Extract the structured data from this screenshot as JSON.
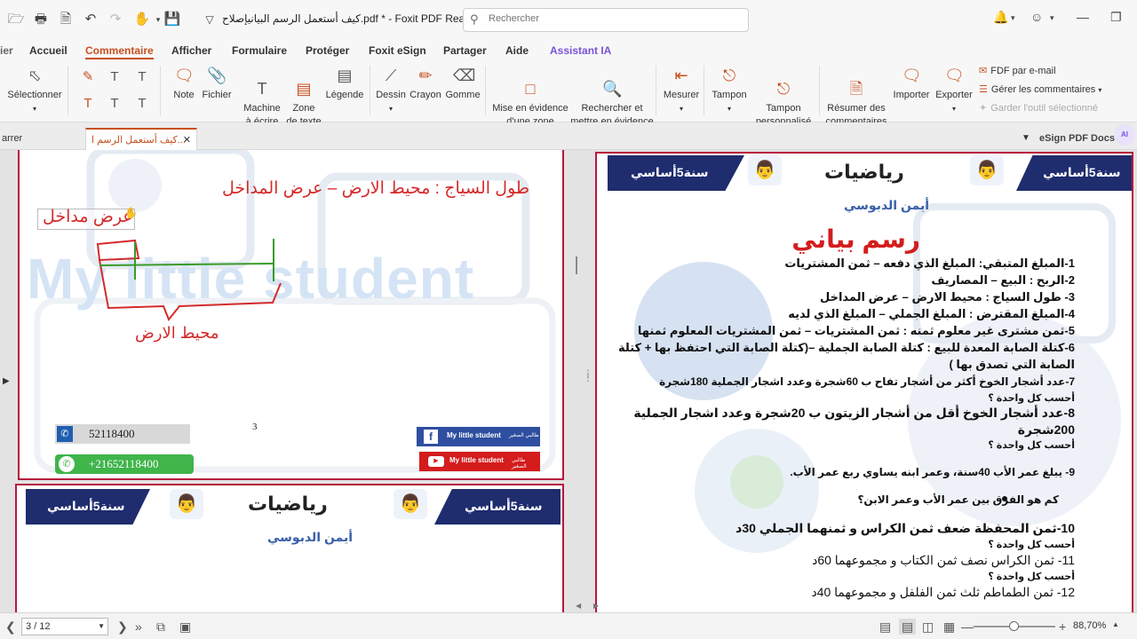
{
  "app": {
    "title": "كيف أستعمل الرسم البيانيإصلاح.pdf * - Foxit PDF Reader",
    "search_placeholder": "Rechercher"
  },
  "menu": {
    "items": [
      "Accueil",
      "Commentaire",
      "Afficher",
      "Formulaire",
      "Protéger",
      "Foxit eSign",
      "Partager",
      "Aide",
      "Assistant IA"
    ],
    "active": "Commentaire"
  },
  "ribbon": {
    "select": "Sélectionner",
    "note": "Note",
    "file": "Fichier",
    "typewriter": "Machine\nà écrire",
    "textbox": "Zone\nde texte",
    "legend": "Légende",
    "drawing": "Dessin",
    "pencil": "Crayon",
    "eraser": "Gomme",
    "area_highlight": "Mise en évidence\nd'une zone",
    "search_highlight": "Rechercher et\nmettre en évidence",
    "measure": "Mesurer",
    "stamp": "Tampon",
    "custom_stamp": "Tampon\npersonnalisé",
    "summarize": "Résumer des\ncommentaires",
    "import": "Importer",
    "export": "Exporter",
    "fdf_email": "FDF par e-mail",
    "manage_comments": "Gérer les commentaires",
    "keep_tool": "Garder l'outil sélectionné"
  },
  "tabs": {
    "left": "arrer",
    "active": "كيف أستعمل الرسم ا...",
    "esign": "eSign PDF Docs",
    "ai_badge": "AI"
  },
  "left_page": {
    "heading": "طول السياج : محيط الارض – عرض المداخل",
    "label_width": "عرض مداخل",
    "label_perimeter": "محيط الارض",
    "watermark": "My little student",
    "page_number": "3",
    "phone1": "52118400",
    "phone2": "+21652118400",
    "facebook": "My little student",
    "youtube": "My little student",
    "social_ar": "طالبي الصغير"
  },
  "left_page2": {
    "banner_left": "سنة5أساسي",
    "banner_right": "سنة5أساسي",
    "subject": "رياضيات",
    "author": "أيمن الدبوسي"
  },
  "right_page": {
    "banner_left": "سنة5أساسي",
    "banner_right": "سنة5أساسي",
    "subject": "رياضيات",
    "author": "أيمن الدبوسي",
    "title": "رسم بياني",
    "lines": [
      "1-المبلغ المتبقي:  المبلغ الذي دفعه – ثمن المشتريات",
      "2-الربح : البيع – المصاريف",
      "3- طول السياج : محيط الارض – عرض المداخل",
      "4-المبلغ المقترض : المبلغ الجملي – المبلغ الذي لديه",
      "5-ثمن مشترى غير معلوم ثمنه : ثمن المشتريات – ثمن المشتريات المعلوم ثمنها",
      "6-كتلة الصابة المعدة للبيع : كتلة الصابة الجملية –(كتلة الصابة التي احتفظ بها + كتلة",
      "الصابة التي تصدق بها )",
      "7-عدد أشجار الخوخ أكثر من أشجار تفاح ب 60شجرة وعدد اشجار الجملية 180شجرة",
      "أحسب كل واحدة ؟",
      "8-عدد أشجار الخوخ أقل من أشجار الزيتون ب 20شجرة  وعدد اشجار الجملية",
      "200شجرة",
      "أحسب كل واحدة ؟",
      "9- يبلغ عمر الأب  40سنة، وعمر ابنه يساوي ربع عمر الأب.",
      "كم هو الفرق بين عمر الأب وعمر الابن؟",
      "10-ثمن المحفظة ضعف ثمن الكراس و ثمنهما الجملي 30د",
      "أحسب كل واحدة ؟",
      "11- ثمن الكراس نصف ثمن الكتاب و مجموعهما 60د",
      "أحسب كل واحدة ؟",
      "12- ثمن الطماطم ثلث ثمن الفلفل و مجموعهما 40د"
    ]
  },
  "status": {
    "page": "3 / 12",
    "zoom": "88,70%",
    "zoom_level": 0.5
  }
}
